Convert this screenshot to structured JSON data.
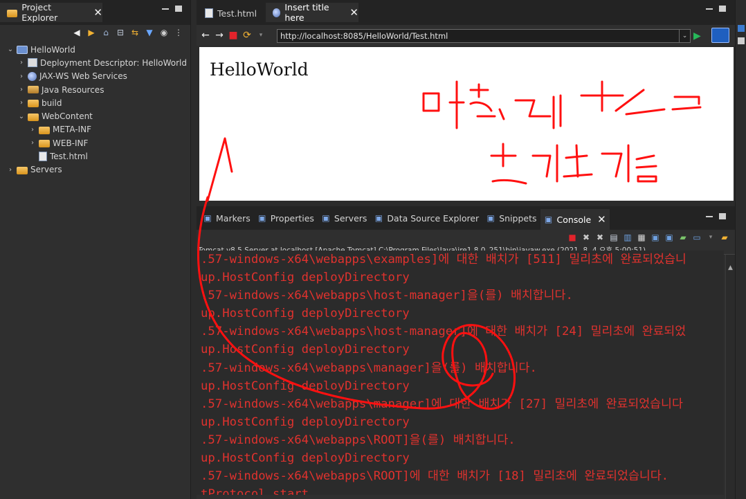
{
  "project_explorer": {
    "title": "Project Explorer",
    "close": "✕",
    "tree": [
      {
        "label": "HelloWorld",
        "depth": 0,
        "twisty": "⌄",
        "icon": "project-icon"
      },
      {
        "label": "Deployment Descriptor: HelloWorld",
        "depth": 1,
        "twisty": "›",
        "icon": "deployment-descriptor-icon"
      },
      {
        "label": "JAX-WS Web Services",
        "depth": 1,
        "twisty": "›",
        "icon": "web-services-icon"
      },
      {
        "label": "Java Resources",
        "depth": 1,
        "twisty": "›",
        "icon": "java-resources-icon"
      },
      {
        "label": "build",
        "depth": 1,
        "twisty": "›",
        "icon": "folder-icon"
      },
      {
        "label": "WebContent",
        "depth": 1,
        "twisty": "⌄",
        "icon": "folder-icon"
      },
      {
        "label": "META-INF",
        "depth": 2,
        "twisty": "›",
        "icon": "folder-icon"
      },
      {
        "label": "WEB-INF",
        "depth": 2,
        "twisty": "›",
        "icon": "folder-icon"
      },
      {
        "label": "Test.html",
        "depth": 2,
        "twisty": "",
        "icon": "html-file-icon"
      },
      {
        "label": "Servers",
        "depth": 0,
        "twisty": "›",
        "icon": "folder-icon"
      }
    ]
  },
  "editor": {
    "tabs": [
      {
        "label": "Test.html",
        "active": false
      },
      {
        "label": "Insert title here",
        "active": true
      }
    ],
    "close": "✕",
    "url": "http://localhost:8085/HelloWorld/Test.html",
    "page_heading": "HelloWorld"
  },
  "console": {
    "tabs": [
      {
        "label": "Markers",
        "icon": "markers-icon"
      },
      {
        "label": "Properties",
        "icon": "properties-icon"
      },
      {
        "label": "Servers",
        "icon": "servers-icon"
      },
      {
        "label": "Data Source Explorer",
        "icon": "data-source-icon"
      },
      {
        "label": "Snippets",
        "icon": "snippets-icon"
      },
      {
        "label": "Console",
        "icon": "console-icon",
        "active": true
      }
    ],
    "close": "✕",
    "header": "Tomcat v8.5 Server at localhost [Apache Tomcat] C:\\Program Files\\Java\\jre1.8.0_251\\bin\\javaw.exe  (2021. 8. 4 오후 5:00:51)",
    "lines": [
      ".57-windows-x64\\webapps\\examples]에 대한 배치가 [511] 밀리초에 완료되었습니",
      "up.HostConfig deployDirectory",
      ".57-windows-x64\\webapps\\host-manager]을(를) 배치합니다.",
      "up.HostConfig deployDirectory",
      ".57-windows-x64\\webapps\\host-manager]에 대한 배치가 [24] 밀리초에 완료되었",
      "up.HostConfig deployDirectory",
      ".57-windows-x64\\webapps\\manager]을(를) 배치합니다.",
      "up.HostConfig deployDirectory",
      ".57-windows-x64\\webapps\\manager]에 대한 배치가 [27] 밀리초에 완료되었습니다",
      "up.HostConfig deployDirectory",
      ".57-windows-x64\\webapps\\ROOT]을(를) 배치합니다.",
      "up.HostConfig deployDirectory",
      ".57-windows-x64\\webapps\\ROOT]에 대한 배치가 [18] 밀리초에 완료되었습니다.",
      "tProtocol start"
    ]
  },
  "colors": {
    "console_text": "#e0322e",
    "annotation_ink": "#ff1010",
    "browser_bg": "#ffffff",
    "panel_bg": "#2f2f2f"
  }
}
